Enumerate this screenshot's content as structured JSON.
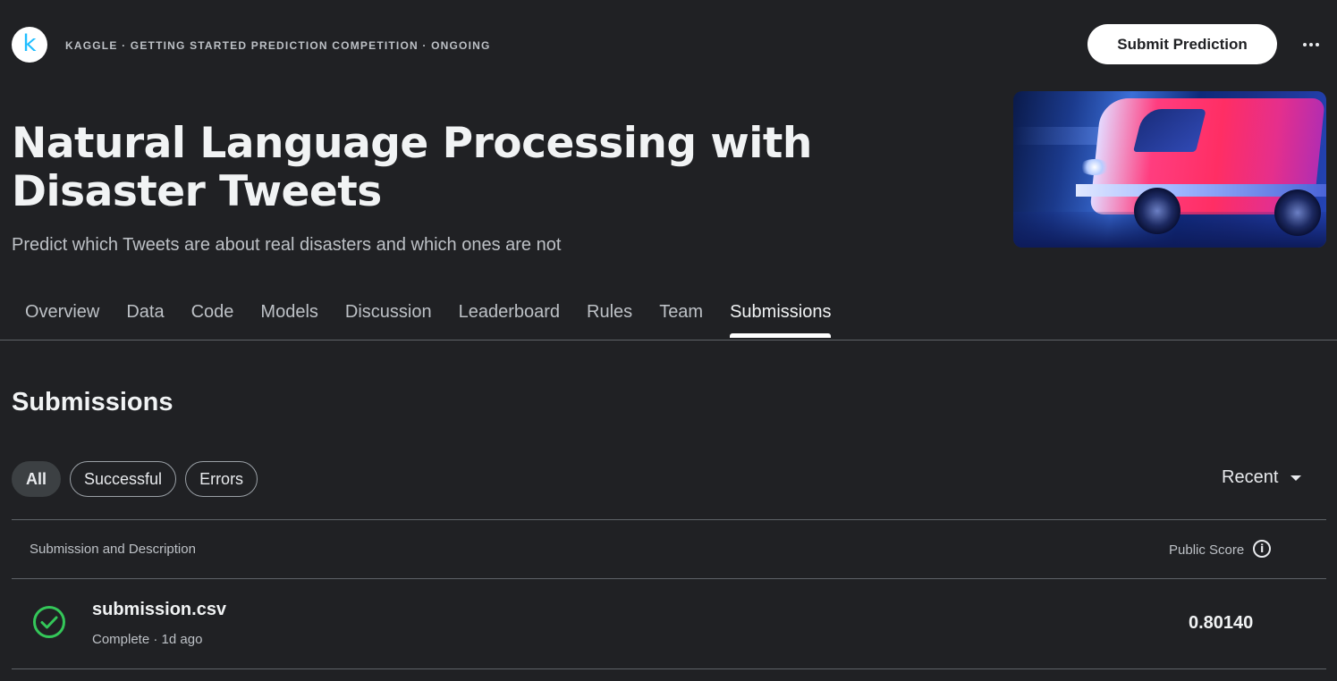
{
  "logo": {
    "glyph": "k"
  },
  "breadcrumb": "KAGGLE · GETTING STARTED PREDICTION COMPETITION · ONGOING",
  "header": {
    "submit_label": "Submit Prediction",
    "more_icon": "more-horizontal-icon",
    "title": "Natural Language Processing with Disaster Tweets",
    "subtitle": "Predict which Tweets are about real disasters and which ones are not"
  },
  "tabs": [
    {
      "label": "Overview",
      "active": false
    },
    {
      "label": "Data",
      "active": false
    },
    {
      "label": "Code",
      "active": false
    },
    {
      "label": "Models",
      "active": false
    },
    {
      "label": "Discussion",
      "active": false
    },
    {
      "label": "Leaderboard",
      "active": false
    },
    {
      "label": "Rules",
      "active": false
    },
    {
      "label": "Team",
      "active": false
    },
    {
      "label": "Submissions",
      "active": true
    }
  ],
  "submissions": {
    "title": "Submissions",
    "filters": [
      {
        "label": "All",
        "active": true
      },
      {
        "label": "Successful",
        "active": false
      },
      {
        "label": "Errors",
        "active": false
      }
    ],
    "sort_label": "Recent",
    "columns": {
      "left": "Submission and Description",
      "right": "Public Score",
      "info_icon": "i"
    },
    "rows": [
      {
        "file": "submission.csv",
        "status": "Complete · 1d ago",
        "score": "0.80140",
        "status_icon": "check-circle-icon"
      }
    ]
  },
  "colors": {
    "background": "#202124",
    "success": "#34c759",
    "brand": "#20beff"
  }
}
